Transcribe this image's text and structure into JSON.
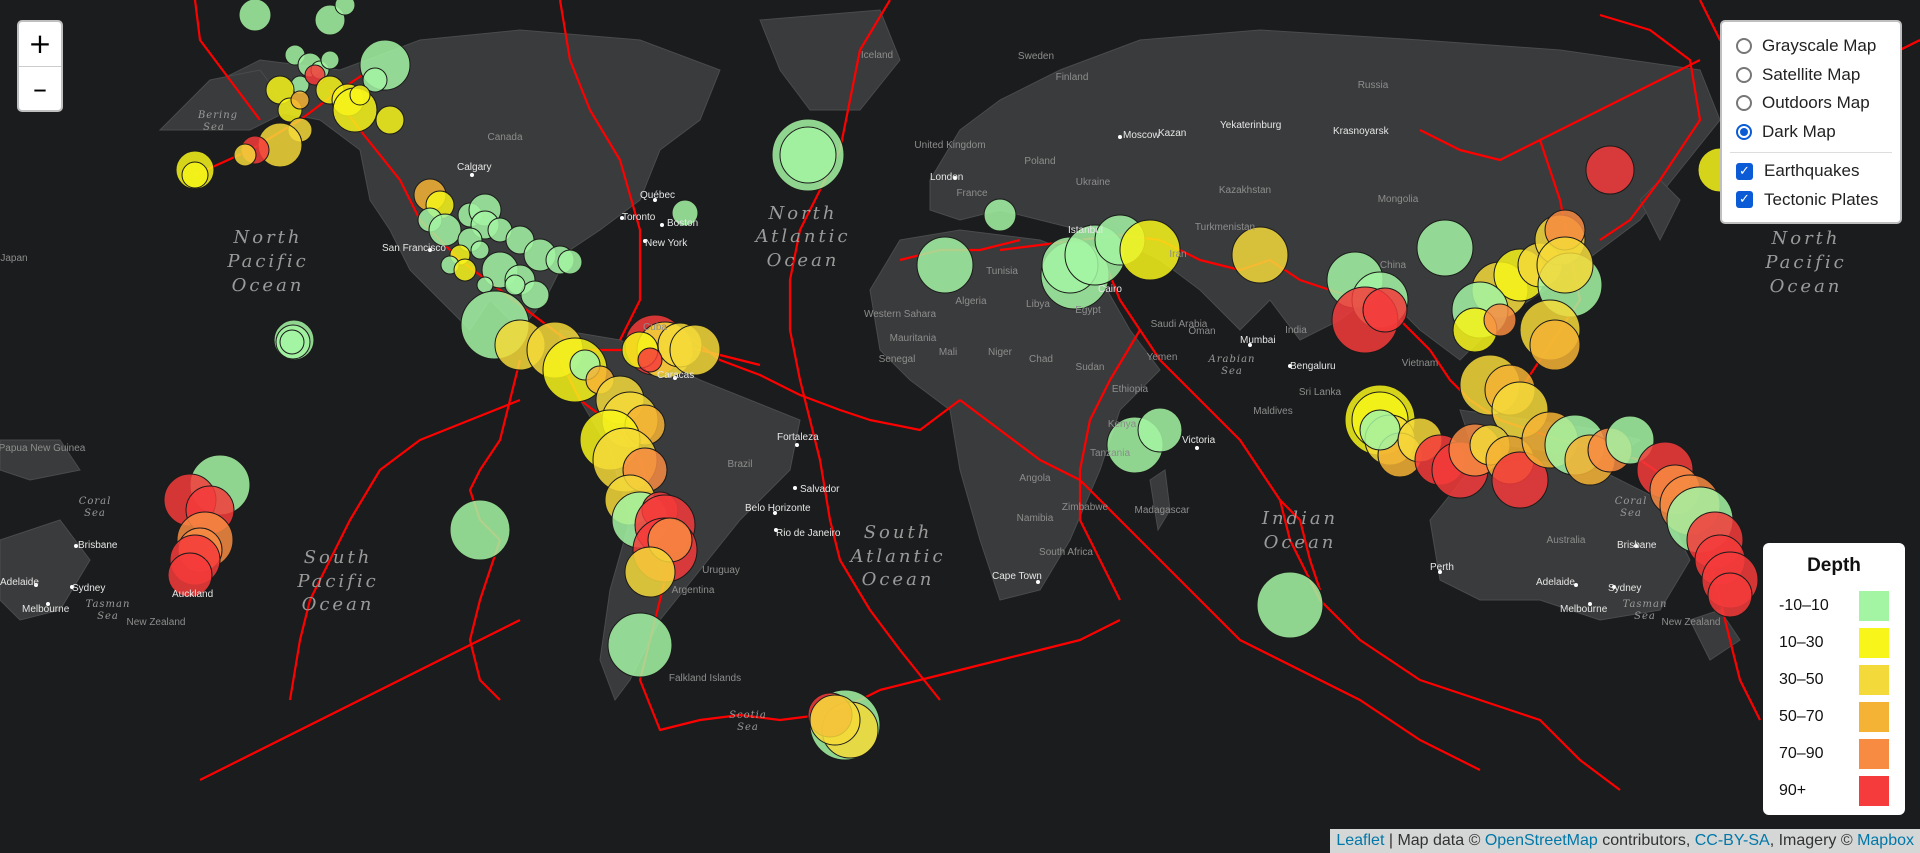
{
  "map": {
    "ocean_labels": [
      "North Pacific Ocean",
      "North Atlantic Ocean",
      "South Pacific Ocean",
      "South Atlantic Ocean",
      "Indian Ocean",
      "North Pacific Ocean"
    ],
    "sea_labels": [
      "Bering Sea",
      "Coral Sea",
      "Tasman Sea",
      "Scotia Sea",
      "Arabian Sea",
      "Coral Sea",
      "Tasman Sea"
    ],
    "cities": [
      "Calgary",
      "Québec",
      "Toronto",
      "Boston",
      "New York",
      "San Francisco",
      "Caracas",
      "Fortaleza",
      "Salvador",
      "Belo Horizonte",
      "Rio de Janeiro",
      "London",
      "Moscow",
      "Kazan",
      "Yekaterinburg",
      "Cairo",
      "Mumbai",
      "Bengaluru",
      "Victoria",
      "Cape Town",
      "Perth",
      "Adelaide",
      "Melbourne",
      "Sydney",
      "Brisbane",
      "Auckland",
      "Krasnoyarsk",
      "Istanbul"
    ],
    "countries": [
      "Canada",
      "Cuba",
      "Brazil",
      "Argentina",
      "Uruguay",
      "Iceland",
      "Sweden",
      "Finland",
      "Russia",
      "United Kingdom",
      "Poland",
      "France",
      "Ukraine",
      "Kazakhstan",
      "Mongolia",
      "China",
      "India",
      "Iran",
      "Egypt",
      "Libya",
      "Algeria",
      "Mali",
      "Niger",
      "Chad",
      "Sudan",
      "Ethiopia",
      "Kenya",
      "Tanzania",
      "Angola",
      "Namibia",
      "South Africa",
      "Madagascar",
      "Saudi Arabia",
      "Oman",
      "Yemen",
      "Sri Lanka",
      "Maldives",
      "Vietnam",
      "Australia",
      "New Zealand",
      "Papua New Guinea",
      "Japan",
      "Senegal",
      "Mauritania",
      "Western Sahara",
      "Tunisia",
      "Zimbabwe",
      "Turkmenistan",
      "Falkland Islands (Islas Malvinas)"
    ],
    "quake_colors": {
      "d0": "#a3f4a3",
      "d1": "#f7f51a",
      "d2": "#f4d93a",
      "d3": "#f4b334",
      "d4": "#f78b42",
      "d5": "#f53b3b"
    }
  },
  "zoom": {
    "in_label": "+",
    "out_label": "–"
  },
  "layers": {
    "base": [
      {
        "label": "Grayscale Map",
        "selected": false
      },
      {
        "label": "Satellite Map",
        "selected": false
      },
      {
        "label": "Outdoors Map",
        "selected": false
      },
      {
        "label": "Dark Map",
        "selected": true
      }
    ],
    "overlays": [
      {
        "label": "Earthquakes",
        "checked": true
      },
      {
        "label": "Tectonic Plates",
        "checked": true
      }
    ]
  },
  "legend": {
    "title": "Depth",
    "items": [
      {
        "label": "-10–10",
        "color": "#a3f4a3"
      },
      {
        "label": "10–30",
        "color": "#f7f51a"
      },
      {
        "label": "30–50",
        "color": "#f4d93a"
      },
      {
        "label": "50–70",
        "color": "#f4b334"
      },
      {
        "label": "70–90",
        "color": "#f78b42"
      },
      {
        "label": "90+",
        "color": "#f53b3b"
      }
    ]
  },
  "attribution": {
    "leaflet": "Leaflet",
    "sep": " | Map data © ",
    "osm": "OpenStreetMap",
    "contributors": " contributors, ",
    "license": "CC-BY-SA",
    "imagery": ", Imagery © ",
    "mapbox": "Mapbox"
  }
}
